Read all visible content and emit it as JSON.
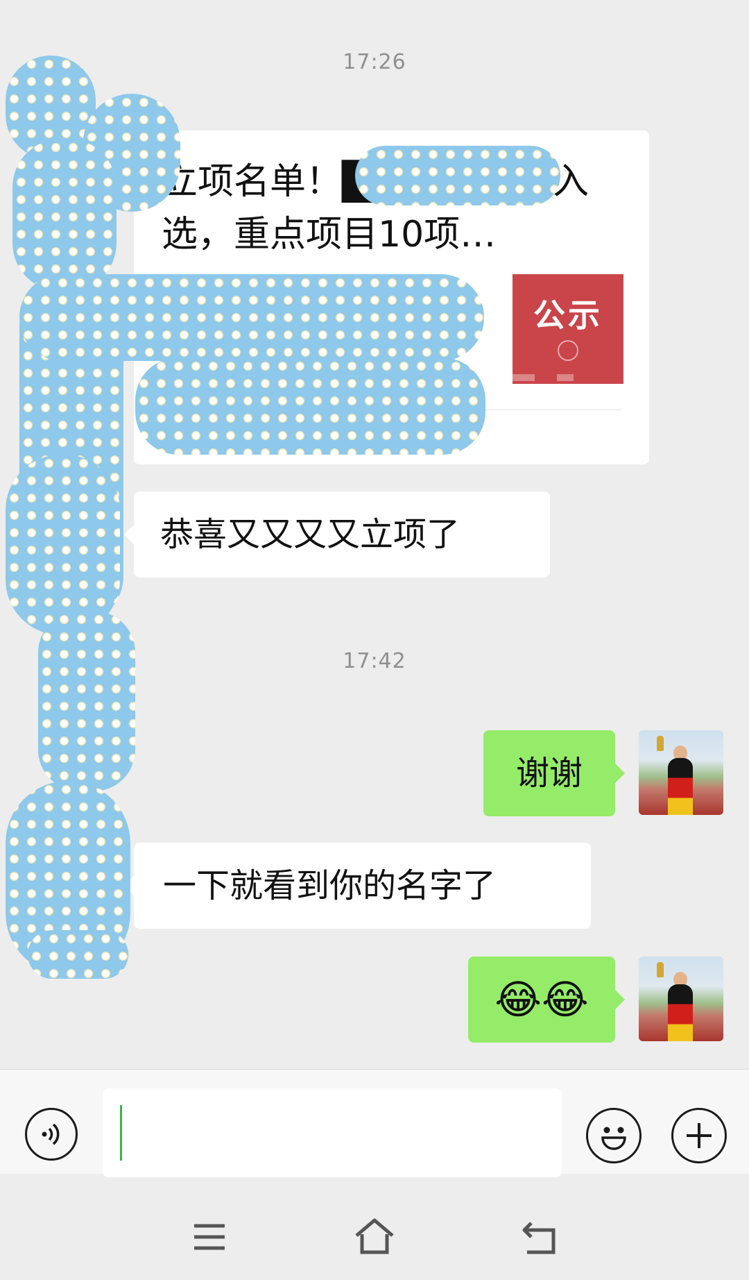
{
  "timestamps": [
    "17:26",
    "17:42"
  ],
  "link_card": {
    "title": "立项名单！█████讲师入选，重点项目10项…",
    "thumbnail_text": "公示",
    "description_redacted": true
  },
  "messages": [
    {
      "side": "left",
      "text": "恭喜又又又又立项了"
    },
    {
      "side": "right",
      "text": "谢谢"
    },
    {
      "side": "left",
      "text": "一下就看到你的名字了"
    },
    {
      "side": "right",
      "text": "😂😂"
    }
  ],
  "composer": {
    "input_value": "",
    "voice_icon": "voice-icon",
    "emoji_icon": "emoji-icon",
    "more_icon": "plus-icon"
  },
  "nav": {
    "menu_icon": "menu-icon",
    "home_icon": "home-icon",
    "back_icon": "back-icon"
  },
  "colors": {
    "background": "#ededed",
    "incoming_bubble": "#ffffff",
    "outgoing_bubble": "#95ec69",
    "caret": "#3fb152",
    "redaction": "#8ec8ea"
  }
}
